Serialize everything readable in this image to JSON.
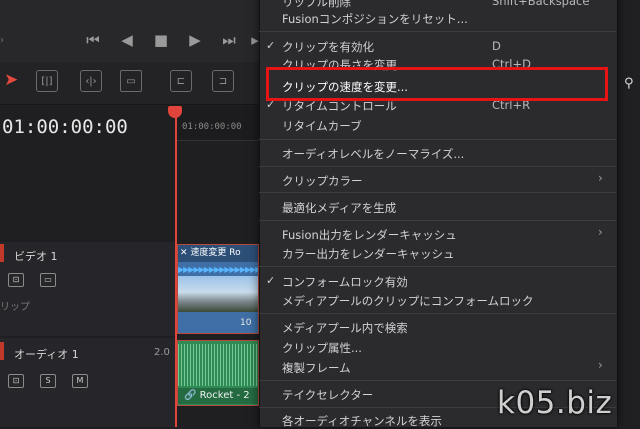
{
  "timeline": {
    "timecode": "01:00:00:00",
    "ruler_label": "01:00:00:00"
  },
  "tracks": {
    "video": {
      "name": "ビデオ 1",
      "partial_label": "リップ"
    },
    "audio": {
      "name": "オーディオ 1",
      "level": "2.0",
      "btn_s": "S",
      "btn_m": "M"
    }
  },
  "clips": {
    "video": {
      "header": "速度変更  Ro",
      "footer": "10"
    },
    "audio": {
      "label": "Rocket - 2"
    }
  },
  "menu": {
    "items": [
      {
        "label": "リップル削除",
        "shortcut": "Shift+Backspace"
      },
      {
        "label": "Fusionコンポジションをリセット..."
      },
      {
        "label": "クリップを有効化",
        "shortcut": "D",
        "checked": true
      },
      {
        "label": "クリップの長さを変更...",
        "shortcut": "Ctrl+D"
      },
      {
        "label": "クリップの速度を変更...",
        "highlighted": true
      },
      {
        "label": "リタイムコントロール",
        "shortcut": "Ctrl+R",
        "checked": true
      },
      {
        "label": "リタイムカーブ"
      },
      {
        "label": "オーディオレベルをノーマライズ..."
      },
      {
        "label": "クリップカラー",
        "submenu": true
      },
      {
        "label": "最適化メディアを生成"
      },
      {
        "label": "Fusion出力をレンダーキャッシュ",
        "submenu": true
      },
      {
        "label": "カラー出力をレンダーキャッシュ"
      },
      {
        "label": "コンフォームロック有効",
        "checked": true
      },
      {
        "label": "メディアプールのクリップにコンフォームロック"
      },
      {
        "label": "メディアプール内で検索"
      },
      {
        "label": "クリップ属性..."
      },
      {
        "label": "複製フレーム",
        "submenu": true
      },
      {
        "label": "テイクセレクター"
      },
      {
        "label": "各オーディオチャンネルを表示"
      }
    ],
    "check_mark": "✓",
    "submenu_arrow": "›"
  },
  "watermark": "k05.biz",
  "colors": {
    "highlight_border": "#e61414",
    "playhead": "#e0443a",
    "video_clip": "#3f6fa6",
    "audio_clip": "#2f8a55"
  }
}
